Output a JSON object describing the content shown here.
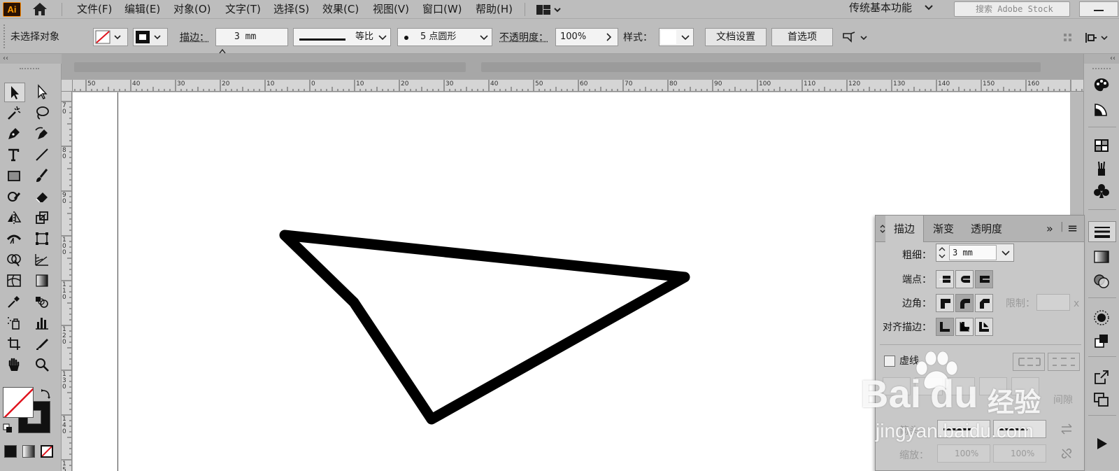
{
  "app": {
    "logo_text": "Ai",
    "brand_color": "#ff9a00"
  },
  "menu": {
    "items": [
      "文件(F)",
      "编辑(E)",
      "对象(O)",
      "文字(T)",
      "选择(S)",
      "效果(C)",
      "视图(V)",
      "窗口(W)",
      "帮助(H)"
    ],
    "workspace_label": "传统基本功能",
    "search_placeholder": "搜索 Adobe Stock"
  },
  "control_bar": {
    "selection_label": "未选择对象",
    "stroke_label": "描边：",
    "stroke_weight": "3 mm",
    "profile_label": "等比",
    "brush_label": "5 点圆形",
    "opacity_label": "不透明度：",
    "opacity_value": "100%",
    "style_label": "样式：",
    "doc_setup_button": "文档设置",
    "preferences_button": "首选项"
  },
  "toolbar": {
    "collapse_glyph": "‹‹",
    "tools": [
      "selection",
      "direct-selection",
      "magic-wand",
      "lasso",
      "pen",
      "curvature",
      "type",
      "line-segment",
      "rectangle",
      "paintbrush",
      "shaper",
      "eraser",
      "rotate",
      "scale",
      "width",
      "free-transform",
      "shape-builder",
      "perspective-grid",
      "mesh",
      "gradient",
      "eyedropper",
      "blend",
      "symbol-sprayer",
      "column-graph",
      "artboard",
      "slice",
      "hand",
      "zoom"
    ]
  },
  "ruler": {
    "horizontal": [
      "50",
      "40",
      "30",
      "20",
      "10",
      "0",
      "10",
      "20",
      "30",
      "40",
      "50",
      "60",
      "70",
      "80",
      "90",
      "100",
      "110",
      "120",
      "130",
      "140",
      "150",
      "160"
    ],
    "vertical": [
      "7 0",
      "8 0",
      "9 0",
      "1 0 0",
      "1 1 0",
      "1 2 0",
      "1 3 0",
      "1 4 0",
      "1 5"
    ]
  },
  "document_tab": {
    "close_glyph": "×"
  },
  "dock": {
    "collapse_glyph": "‹‹"
  },
  "stroke_panel": {
    "tabs": [
      "描边",
      "渐变",
      "透明度"
    ],
    "active_tab": "描边",
    "weight_label": "粗细：",
    "weight_value": "3 mm",
    "cap_label": "端点：",
    "corner_label": "边角：",
    "limit_label": "限制：",
    "limit_unit": "x",
    "align_label": "对齐描边：",
    "dashed_label": "虚线",
    "gap_label": "间隙",
    "arrow_label": "箭头：",
    "scale_label": "缩放：",
    "scale_start": "100%",
    "scale_end": "100%",
    "expand_glyph": "»",
    "menu_glyph": "≡"
  },
  "watermark": {
    "brand": "Bai",
    "brand2": "du",
    "site_name": "经验",
    "url": "jingyan.baidu.com"
  },
  "colors": {
    "stroke_color": "#000000",
    "fill": "none",
    "canvas_bg": "#ffffff",
    "chrome_bg": "#bdbdbd"
  }
}
